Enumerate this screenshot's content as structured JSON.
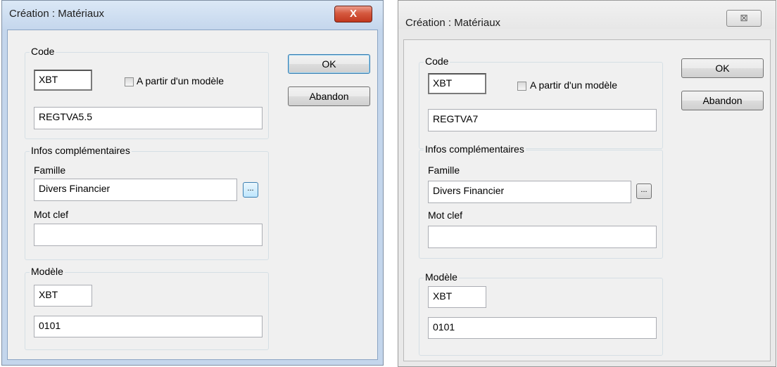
{
  "dialogs": [
    {
      "title": "Création : Matériaux",
      "close_glyph": "X",
      "code_group": {
        "legend": "Code",
        "code_value": "XBT",
        "checkbox_label": "A partir d'un modèle",
        "checkbox_checked": false,
        "name_value": "REGTVA5.5"
      },
      "infos_group": {
        "legend": "Infos complémentaires",
        "famille_label": "Famille",
        "famille_value": "Divers Financier",
        "browse_label": "...",
        "motclef_label": "Mot clef",
        "motclef_value": ""
      },
      "modele_group": {
        "legend": "Modèle",
        "code_value": "XBT",
        "number_value": "0101"
      },
      "ok_label": "OK",
      "cancel_label": "Abandon"
    },
    {
      "title": "Création : Matériaux",
      "close_glyph": "⊠",
      "code_group": {
        "legend": "Code",
        "code_value": "XBT",
        "checkbox_label": "A partir d'un modèle",
        "checkbox_checked": false,
        "name_value": "REGTVA7"
      },
      "infos_group": {
        "legend": "Infos complémentaires",
        "famille_label": "Famille",
        "famille_value": "Divers Financier",
        "browse_label": "...",
        "motclef_label": "Mot clef",
        "motclef_value": ""
      },
      "modele_group": {
        "legend": "Modèle",
        "code_value": "XBT",
        "number_value": "0101"
      },
      "ok_label": "OK",
      "cancel_label": "Abandon"
    }
  ]
}
